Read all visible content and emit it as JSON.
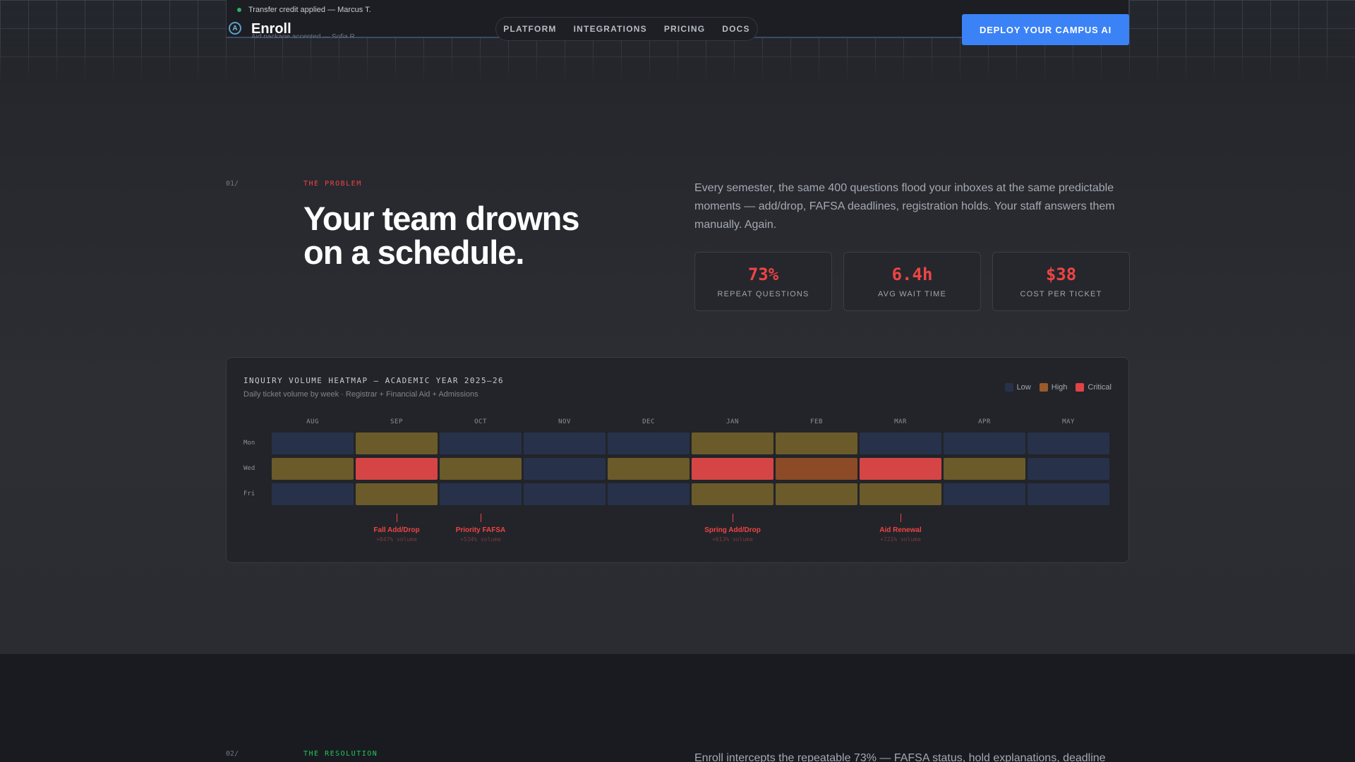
{
  "header": {
    "brand": "Enroll",
    "logo_glyph": "A",
    "ticker_primary": "Transfer credit applied — Marcus T.",
    "ticker_secondary": "Aid package accepted — Sofia R.",
    "nav": [
      "PLATFORM",
      "INTEGRATIONS",
      "PRICING",
      "DOCS"
    ],
    "cta_label": "DEPLOY YOUR CAMPUS AI"
  },
  "problem": {
    "number": "01/",
    "eyebrow": "THE PROBLEM",
    "headline_line1": "Your team drowns",
    "headline_line2": "on a schedule.",
    "lede": "Every semester, the same 400 questions flood your inboxes at the same predictable moments — add/drop, FAFSA deadlines, registration holds. Your staff answers them manually. Again.",
    "stats": [
      {
        "value": "73%",
        "label": "REPEAT QUESTIONS"
      },
      {
        "value": "6.4h",
        "label": "AVG WAIT TIME"
      },
      {
        "value": "$38",
        "label": "COST PER TICKET"
      }
    ]
  },
  "heatmap": {
    "title": "INQUIRY VOLUME HEATMAP — ACADEMIC YEAR 2025–26",
    "subtitle": "Daily ticket volume by week · Registrar + Financial Aid + Admissions",
    "legend": [
      {
        "label": "Low",
        "color": "#27324a"
      },
      {
        "label": "High",
        "color": "#9a5a2a"
      },
      {
        "label": "Critical",
        "color": "#e04444"
      }
    ],
    "level_colors": {
      "low": "#27324a",
      "medium": "#6b5a2a",
      "high": "#8c4a26",
      "critical": "#d64545"
    },
    "months": [
      "AUG",
      "SEP",
      "OCT",
      "NOV",
      "DEC",
      "JAN",
      "FEB",
      "MAR",
      "APR",
      "MAY"
    ],
    "days": [
      "Mon",
      "Wed",
      "Fri"
    ],
    "rows": [
      [
        "low",
        "medium",
        "low",
        "low",
        "low",
        "medium",
        "medium",
        "low",
        "low",
        "low"
      ],
      [
        "medium",
        "critical",
        "medium",
        "low",
        "medium",
        "critical",
        "high",
        "critical",
        "medium",
        "low"
      ],
      [
        "low",
        "medium",
        "low",
        "low",
        "low",
        "medium",
        "medium",
        "medium",
        "low",
        "low"
      ]
    ],
    "events": [
      {
        "month_index": 1,
        "name": "Fall Add/Drop",
        "volume": "+847% volume"
      },
      {
        "month_index": 2,
        "name": "Priority FAFSA",
        "volume": "+534% volume"
      },
      {
        "month_index": 5,
        "name": "Spring Add/Drop",
        "volume": "+613% volume"
      },
      {
        "month_index": 7,
        "name": "Aid Renewal",
        "volume": "+721% volume"
      }
    ]
  },
  "resolution": {
    "number": "02/",
    "eyebrow": "THE RESOLUTION",
    "lede": "Enroll intercepts the repeatable 73% — FAFSA status, hold explanations, deadline"
  }
}
